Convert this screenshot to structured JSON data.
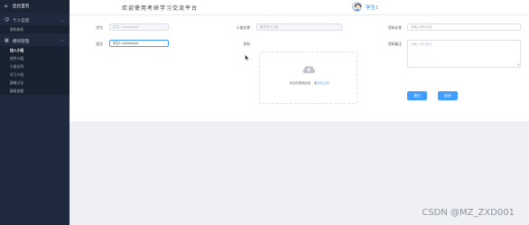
{
  "sidebar": {
    "header": "后台首页",
    "groups": [
      {
        "label": "个人信息",
        "subitems": [
          "密码修改"
        ]
      },
      {
        "label": "模块管理",
        "subitems": [
          "加入小组",
          "组件小组",
          "小组长列",
          "学习小组",
          "疑难讨论",
          "疑难查看"
        ]
      }
    ]
  },
  "topbar": {
    "title": "欢迎使用考研学习交流平台",
    "username": "学生1"
  },
  "form": {
    "student_label": "学生",
    "student_value": "学生1 xuesheng1",
    "group_name_label": "小组名称",
    "group_name_value": "数学学习小组",
    "material_name_label": "资料名称",
    "material_name_placeholder": "请输入资料名称",
    "group_leader_label": "组员",
    "group_leader_value": "学生1 xuesheng1",
    "material_label": "资料",
    "upload_text": "将文件拖到此处，或",
    "upload_link": "点击上传",
    "remark_label": "资料备注",
    "remark_placeholder": "请输入资料备注",
    "submit_label": "提交",
    "cancel_label": "取消"
  },
  "watermark": "CSDN @MZ_ZXD001",
  "colors": {
    "sidebar_bg": "#1f2a3f",
    "primary": "#409eff",
    "username": "#2d8cf0"
  }
}
